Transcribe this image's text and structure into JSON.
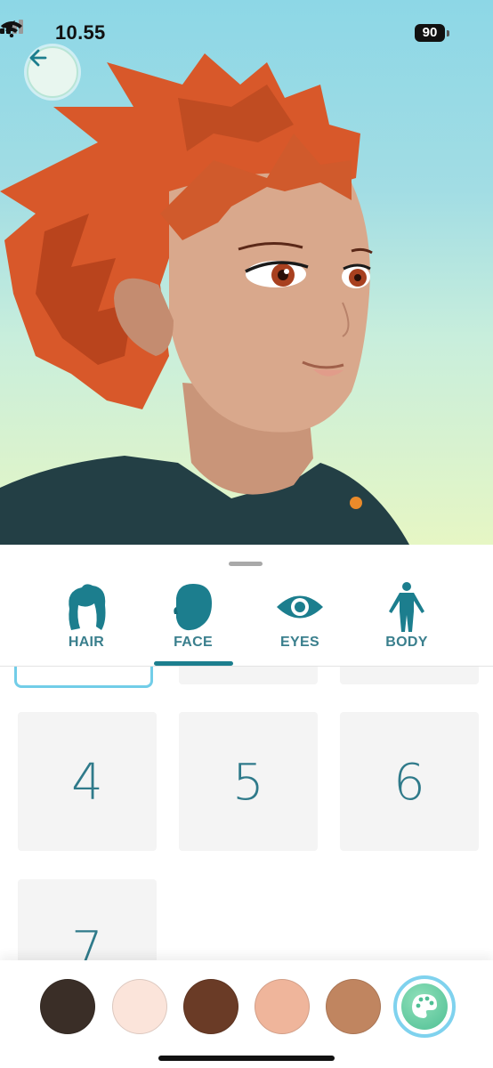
{
  "status_bar": {
    "time": "10.55",
    "battery": "90"
  },
  "tabs": [
    {
      "label": "HAIR",
      "icon": "hair-icon"
    },
    {
      "label": "FACE",
      "icon": "face-icon",
      "selected": true
    },
    {
      "label": "EYES",
      "icon": "eye-icon"
    },
    {
      "label": "BODY",
      "icon": "body-icon"
    }
  ],
  "options": [
    "4",
    "5",
    "6",
    "7"
  ],
  "skin_colors": [
    "#3a2e27",
    "#fbe4da",
    "#6a3b26",
    "#efb59b",
    "#c08560"
  ],
  "colors": {
    "accent": "#1c7e8e",
    "label": "#3a7f8d",
    "selection": "#72cde8"
  }
}
